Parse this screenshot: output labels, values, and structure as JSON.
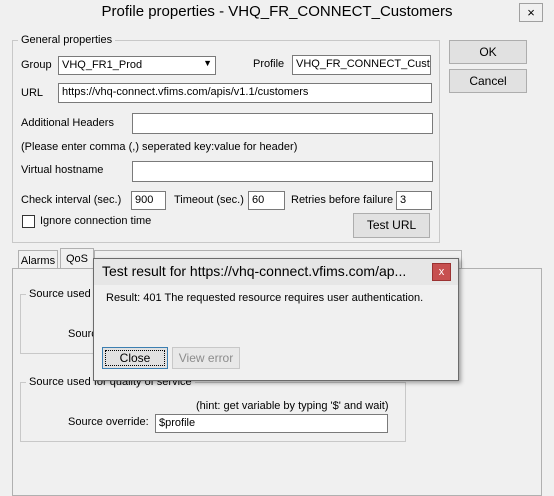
{
  "window": {
    "title": "Profile properties - VHQ_FR_CONNECT_Customers",
    "close_glyph": "×"
  },
  "buttons": {
    "ok": "OK",
    "cancel": "Cancel"
  },
  "general": {
    "legend": "General properties",
    "group_label": "Group",
    "group_value": "VHQ_FR1_Prod",
    "profile_label": "Profile",
    "profile_value": "VHQ_FR_CONNECT_Custo",
    "url_label": "URL",
    "url_value": "https://vhq-connect.vfims.com/apis/v1.1/customers",
    "headers_label": "Additional Headers",
    "headers_value": "",
    "headers_hint": "(Please enter comma (,) seperated key:value for header)",
    "vhost_label": "Virtual hostname",
    "vhost_value": "",
    "check_interval_label": "Check interval (sec.)",
    "check_interval_value": "900",
    "timeout_label": "Timeout (sec.)",
    "timeout_value": "60",
    "retries_label": "Retries before failure",
    "retries_value": "3",
    "ignore_label": "Ignore connection time",
    "test_url_label": "Test URL"
  },
  "tabs": [
    {
      "label": "Alarms"
    },
    {
      "label": "QoS"
    }
  ],
  "tab_panel": {
    "source_used_label": "Source used",
    "source_override_label_partial": "Source",
    "qos_legend": "Source used for quality of service",
    "hint": "(hint: get variable by typing '$' and wait)",
    "source_override_label": "Source override:",
    "source_override_value": "$profile"
  },
  "popup": {
    "title": "Test result for https://vhq-connect.vfims.com/ap...",
    "message": "Result: 401 The requested resource requires user authentication.",
    "close_label": "Close",
    "view_error_label": "View error",
    "close_glyph": "x"
  },
  "colors": {
    "popup_close_bg": "#c75050",
    "window_bg": "#f0f0f0"
  }
}
